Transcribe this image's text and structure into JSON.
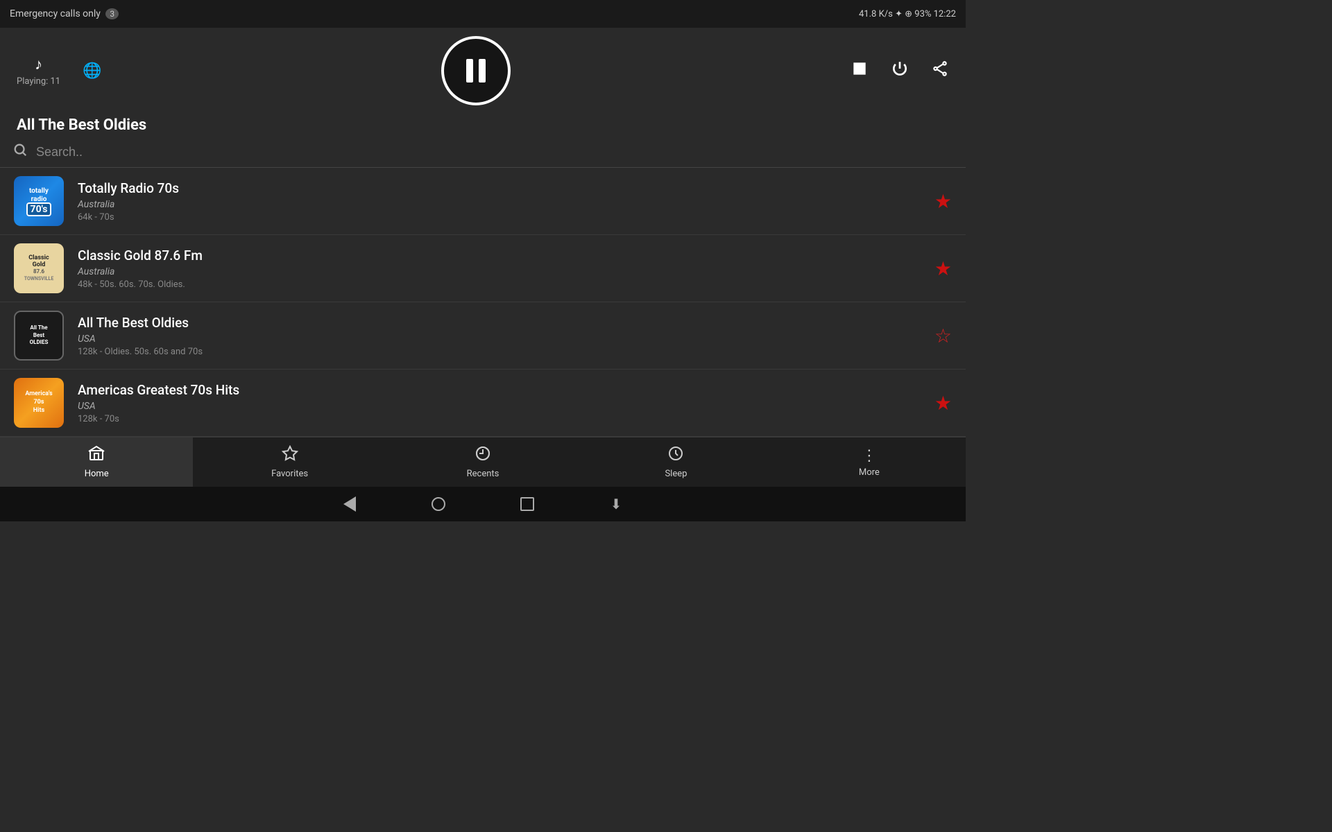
{
  "statusBar": {
    "left": "Emergency calls only",
    "badge": "3",
    "right": "41.8 K/s  ✦  ⊕  93%  12:22"
  },
  "player": {
    "playingLabel": "Playing: 11",
    "stationTitle": "All The Best Oldies"
  },
  "search": {
    "placeholder": "Search.."
  },
  "stations": [
    {
      "id": 1,
      "name": "Totally Radio 70s",
      "country": "Australia",
      "bitrate": "64k - 70s",
      "logoType": "totally",
      "logoText": "totally radio\n70's",
      "favorited": true
    },
    {
      "id": 2,
      "name": "Classic Gold 87.6 Fm",
      "country": "Australia",
      "bitrate": "48k - 50s. 60s. 70s. Oldies.",
      "logoType": "classic",
      "logoText": "Classic Gold",
      "favorited": true
    },
    {
      "id": 3,
      "name": "All The Best Oldies",
      "country": "USA",
      "bitrate": "128k - Oldies. 50s. 60s and 70s",
      "logoType": "oldies",
      "logoText": "All The Best Oldies",
      "favorited": false
    },
    {
      "id": 4,
      "name": "Americas Greatest 70s Hits",
      "country": "USA",
      "bitrate": "128k - 70s",
      "logoType": "americas",
      "logoText": "70s Hits",
      "favorited": true
    }
  ],
  "bottomNav": {
    "items": [
      {
        "id": "home",
        "label": "Home",
        "icon": "home",
        "active": true
      },
      {
        "id": "favorites",
        "label": "Favorites",
        "icon": "star",
        "active": false
      },
      {
        "id": "recents",
        "label": "Recents",
        "icon": "history",
        "active": false
      },
      {
        "id": "sleep",
        "label": "Sleep",
        "icon": "clock",
        "active": false
      },
      {
        "id": "more",
        "label": "More",
        "icon": "dots",
        "active": false
      }
    ]
  }
}
